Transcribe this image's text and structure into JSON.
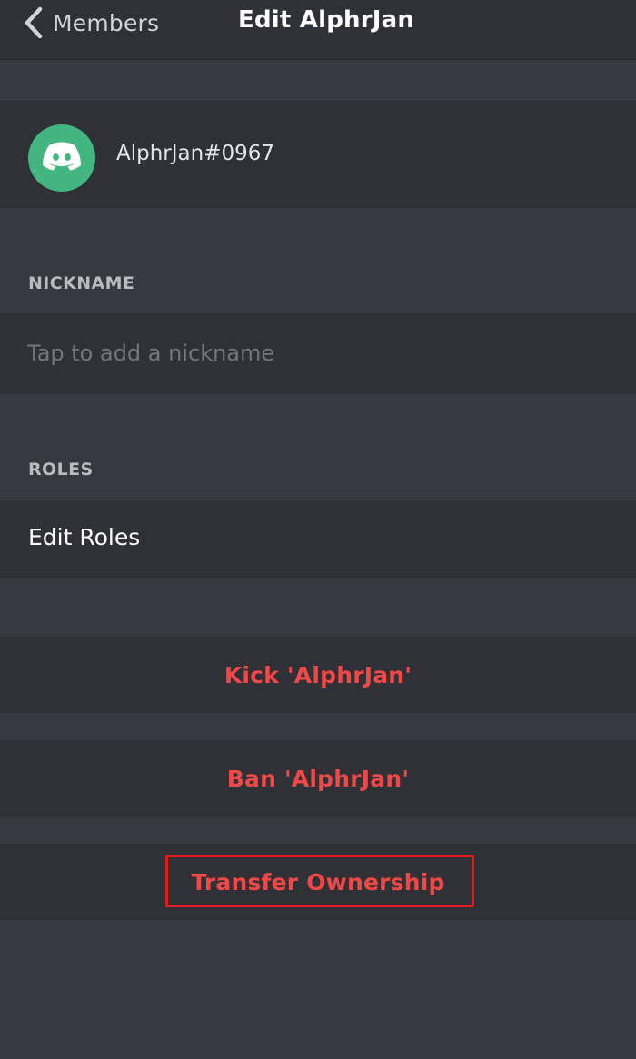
{
  "header": {
    "back_label": "Members",
    "title": "Edit AlphrJan"
  },
  "user": {
    "tag": "AlphrJan#0967",
    "avatar_color": "#43b581"
  },
  "nickname_section": {
    "header": "NICKNAME",
    "placeholder": "Tap to add a nickname"
  },
  "roles_section": {
    "header": "ROLES",
    "edit_label": "Edit Roles"
  },
  "actions": {
    "kick_label": "Kick 'AlphrJan'",
    "ban_label": "Ban 'AlphrJan'",
    "transfer_label": "Transfer Ownership"
  },
  "colors": {
    "background": "#36393f",
    "row_background": "#2f3136",
    "danger": "#f04747",
    "highlight_box": "#e11b1b"
  },
  "icons": [
    "chevron-left-icon",
    "discord-logo-icon"
  ]
}
